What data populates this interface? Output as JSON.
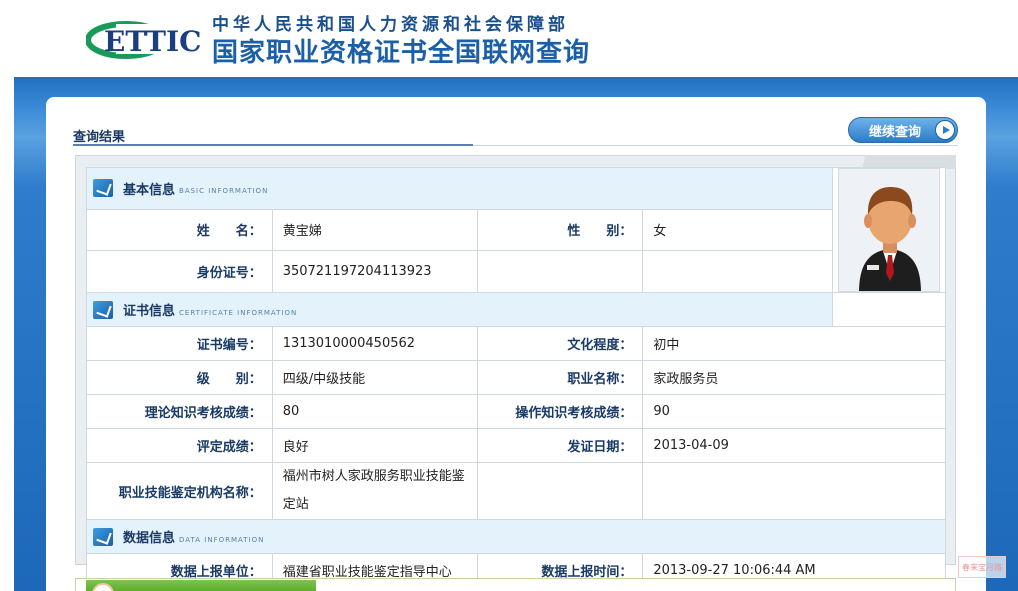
{
  "header": {
    "logo_text": "ETTIC",
    "ministry": "中华人民共和国人力资源和社会保障部",
    "title": "国家职业资格证书全国联网查询"
  },
  "result": {
    "title": "查询结果",
    "continue_label": "继续查询"
  },
  "sections": {
    "basic": {
      "title": "基本信息",
      "subtitle": "BASIC INFORMATION"
    },
    "certificate": {
      "title": "证书信息",
      "subtitle": "CERTIFICATE INFORMATION"
    },
    "data": {
      "title": "数据信息",
      "subtitle": "DATA INFORMATION"
    }
  },
  "basic": {
    "name_label": "姓　　名：",
    "name": "黄宝娣",
    "gender_label": "性　　别：",
    "gender": "女",
    "id_label": "身份证号：",
    "id": "350721197204113923"
  },
  "certificate": {
    "cert_no_label": "证书编号：",
    "cert_no": "1313010000450562",
    "education_label": "文化程度：",
    "education": "初中",
    "level_label": "级　　别：",
    "level": "四级/中级技能",
    "occupation_label": "职业名称：",
    "occupation": "家政服务员",
    "theory_label": "理论知识考核成绩：",
    "theory": "80",
    "practice_label": "操作知识考核成绩：",
    "practice": "90",
    "rating_label": "评定成绩：",
    "rating": "良好",
    "issue_date_label": "发证日期：",
    "issue_date": "2013-04-09",
    "agency_label": "职业技能鉴定机构名称：",
    "agency": "福州市树人家政服务职业技能鉴定站"
  },
  "data": {
    "unit_label": "数据上报单位：",
    "unit": "福建省职业技能鉴定指导中心",
    "time_label": "数据上报时间：",
    "time": "2013-09-27 10:06:44 AM"
  },
  "watermark": "春来宝月路"
}
